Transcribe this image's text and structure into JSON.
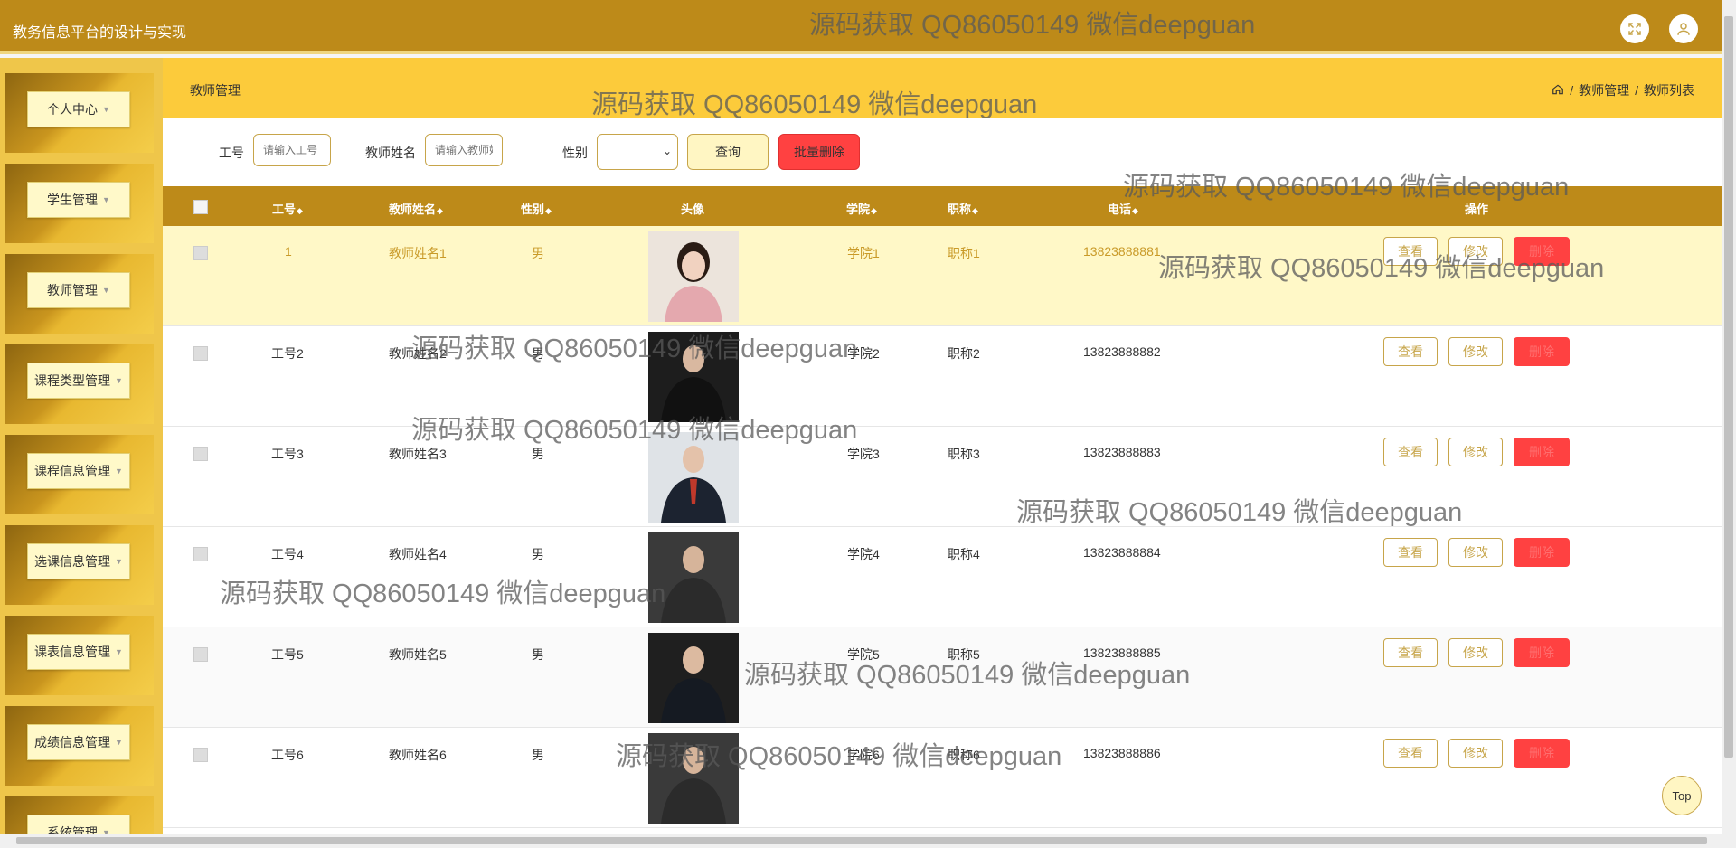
{
  "header": {
    "app_title": "教务信息平台的设计与实现"
  },
  "sidebar": {
    "items": [
      {
        "label": "个人中心"
      },
      {
        "label": "学生管理"
      },
      {
        "label": "教师管理"
      },
      {
        "label": "课程类型管理"
      },
      {
        "label": "课程信息管理"
      },
      {
        "label": "选课信息管理"
      },
      {
        "label": "课表信息管理"
      },
      {
        "label": "成绩信息管理"
      },
      {
        "label": "系统管理"
      }
    ]
  },
  "page": {
    "title": "教师管理",
    "breadcrumb": [
      "教师管理",
      "教师列表"
    ]
  },
  "search": {
    "gonghao_label": "工号",
    "gonghao_placeholder": "请输入工号",
    "name_label": "教师姓名",
    "name_placeholder": "请输入教师姓名",
    "gender_label": "性别",
    "gender_value": "",
    "query_label": "查询",
    "batch_delete_label": "批量删除"
  },
  "table": {
    "headers": {
      "gonghao": "工号",
      "name": "教师姓名",
      "gender": "性别",
      "avatar": "头像",
      "college": "学院",
      "title": "职称",
      "phone": "电话",
      "ops": "操作"
    },
    "actions": {
      "view": "查看",
      "edit": "修改",
      "delete": "删除"
    },
    "rows": [
      {
        "gonghao": "1",
        "name": "教师姓名1",
        "gender": "男",
        "college": "学院1",
        "title": "职称1",
        "phone": "13823888881"
      },
      {
        "gonghao": "工号2",
        "name": "教师姓名2",
        "gender": "男",
        "college": "学院2",
        "title": "职称2",
        "phone": "13823888882"
      },
      {
        "gonghao": "工号3",
        "name": "教师姓名3",
        "gender": "男",
        "college": "学院3",
        "title": "职称3",
        "phone": "13823888883"
      },
      {
        "gonghao": "工号4",
        "name": "教师姓名4",
        "gender": "男",
        "college": "学院4",
        "title": "职称4",
        "phone": "13823888884"
      },
      {
        "gonghao": "工号5",
        "name": "教师姓名5",
        "gender": "男",
        "college": "学院5",
        "title": "职称5",
        "phone": "13823888885"
      },
      {
        "gonghao": "工号6",
        "name": "教师姓名6",
        "gender": "男",
        "college": "学院6",
        "title": "职称6",
        "phone": "13823888886"
      }
    ]
  },
  "watermark": "源码获取 QQ86050149 微信deepguan",
  "back_to_top": "Top",
  "colors": {
    "primary": "#bd8a19",
    "accent": "#fccb3b",
    "danger": "#ff4141",
    "highlight_row": "#fff8c7"
  },
  "icons": [
    "fullscreen-icon",
    "user-icon",
    "home-icon",
    "caret-down-icon",
    "sort-icon"
  ]
}
